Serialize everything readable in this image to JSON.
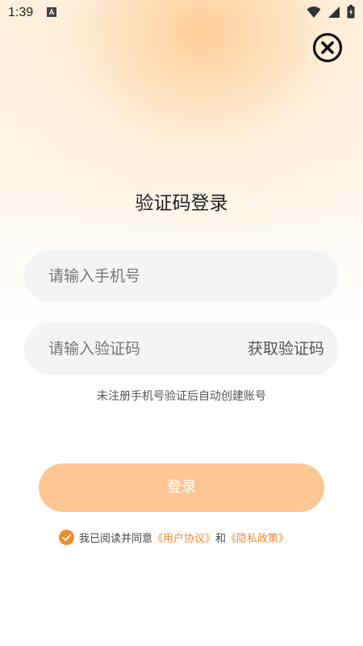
{
  "status_bar": {
    "time": "1:39",
    "notification_icon": "a-icon",
    "right_icons": [
      "wifi-icon",
      "signal-icon",
      "battery-icon"
    ]
  },
  "close_icon": "close-circle-icon",
  "title": "验证码登录",
  "phone_field": {
    "placeholder": "请输入手机号",
    "value": ""
  },
  "code_field": {
    "placeholder": "请输入验证码",
    "value": ""
  },
  "get_code_label": "获取验证码",
  "hint": "未注册手机号验证后自动创建账号",
  "login_button": "登录",
  "agreement": {
    "checked": true,
    "prefix": "我已阅读并同意",
    "user_agreement": "《用户协议》",
    "and": "和",
    "privacy_policy": "《隐私政策》"
  },
  "colors": {
    "accent": "#f08a2c",
    "button": "#fdc795",
    "field_bg": "#f4f4f6"
  }
}
